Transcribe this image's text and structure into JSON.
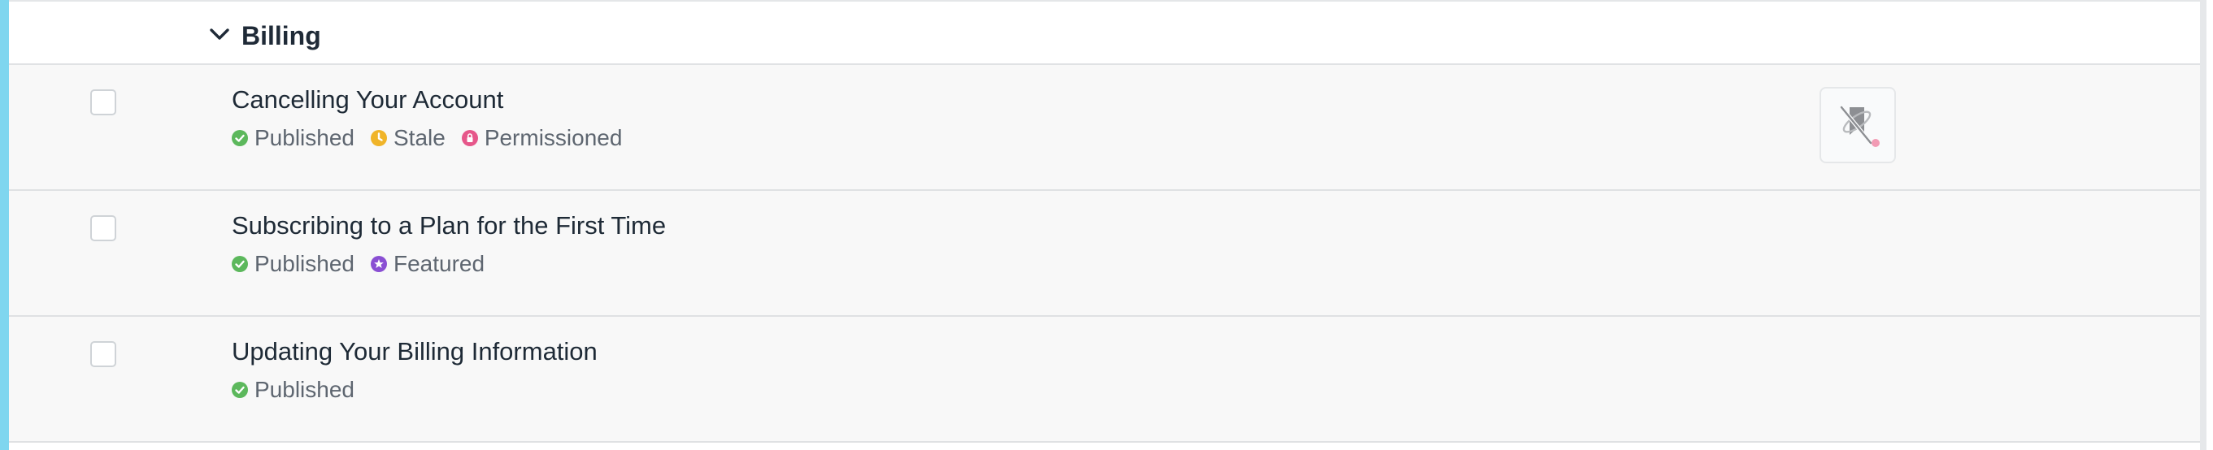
{
  "section": {
    "title": "Billing",
    "expanded": true
  },
  "colors": {
    "accent": "#7fd6ef",
    "published": "#5cb85c",
    "stale": "#f0b429",
    "permissioned": "#e6578a",
    "featured": "#8a4fd3"
  },
  "articles": [
    {
      "title": "Cancelling Your Account",
      "checked": false,
      "statuses": [
        {
          "icon": "check-circle-icon",
          "label": "Published"
        },
        {
          "icon": "stale-clock-icon",
          "label": "Stale"
        },
        {
          "icon": "lock-circle-icon",
          "label": "Permissioned"
        }
      ],
      "action_icon": "unpin-icon"
    },
    {
      "title": "Subscribing to a Plan for the First Time",
      "checked": false,
      "statuses": [
        {
          "icon": "check-circle-icon",
          "label": "Published"
        },
        {
          "icon": "star-circle-icon",
          "label": "Featured"
        }
      ]
    },
    {
      "title": "Updating Your Billing Information",
      "checked": false,
      "statuses": [
        {
          "icon": "check-circle-icon",
          "label": "Published"
        }
      ]
    }
  ]
}
